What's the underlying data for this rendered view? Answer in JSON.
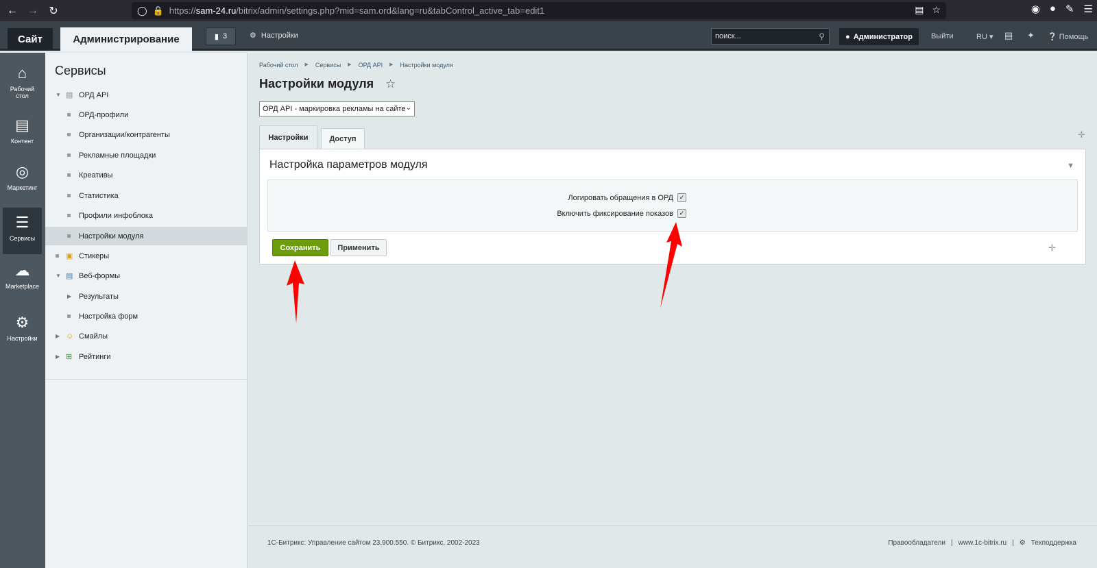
{
  "browser": {
    "url_host": "sam-24.ru",
    "url_prefix": "https://",
    "url_path": "/bitrix/admin/settings.php?mid=sam.ord&lang=ru&tabControl_active_tab=edit1"
  },
  "topbar": {
    "site_label": "Сайт",
    "admin_label": "Администрирование",
    "notif_count": "3",
    "settings_label": "Настройки",
    "search_placeholder": "поиск...",
    "user_label": "Администратор",
    "logout_label": "Выйти",
    "lang_label": "RU",
    "help_label": "Помощь"
  },
  "leftmenu": [
    {
      "label": "Рабочий стол",
      "icon": "home-icon"
    },
    {
      "label": "Контент",
      "icon": "content-icon"
    },
    {
      "label": "Маркетинг",
      "icon": "target-icon"
    },
    {
      "label": "Сервисы",
      "icon": "layers-icon"
    },
    {
      "label": "Marketplace",
      "icon": "cloud-download-icon"
    },
    {
      "label": "Настройки",
      "icon": "gear-icon"
    }
  ],
  "sidebar": {
    "title": "Сервисы",
    "items": [
      {
        "label": "ОРД API"
      },
      {
        "label": "ОРД-профили"
      },
      {
        "label": "Организации/контрагенты"
      },
      {
        "label": "Рекламные площадки"
      },
      {
        "label": "Креативы"
      },
      {
        "label": "Статистика"
      },
      {
        "label": "Профили инфоблока"
      },
      {
        "label": "Настройки модуля"
      },
      {
        "label": "Стикеры"
      },
      {
        "label": "Веб-формы"
      },
      {
        "label": "Результаты"
      },
      {
        "label": "Настройка форм"
      },
      {
        "label": "Смайлы"
      },
      {
        "label": "Рейтинги"
      }
    ]
  },
  "main": {
    "breadcrumb": [
      "Рабочий стол",
      "Сервисы",
      "ОРД API",
      "Настройки модуля"
    ],
    "title": "Настройки модуля",
    "module_select": "ОРД API - маркировка рекламы на сайте",
    "tabs": [
      "Настройки",
      "Доступ"
    ],
    "panel_title": "Настройка параметров модуля",
    "options": [
      {
        "label": "Логировать обращения в ОРД",
        "checked": true
      },
      {
        "label": "Включить фиксирование показов",
        "checked": true
      }
    ],
    "save_label": "Сохранить",
    "apply_label": "Применить"
  },
  "footer": {
    "left": "1С-Битрикс: Управление сайтом 23.900.550. © Битрикс, 2002-2023",
    "link1": "Правообладатели",
    "link2": "www.1c-bitrix.ru",
    "link3": "Техподдержка"
  },
  "colors": {
    "save_green": "#6d9d0d",
    "annotation_red": "#ff0000"
  }
}
